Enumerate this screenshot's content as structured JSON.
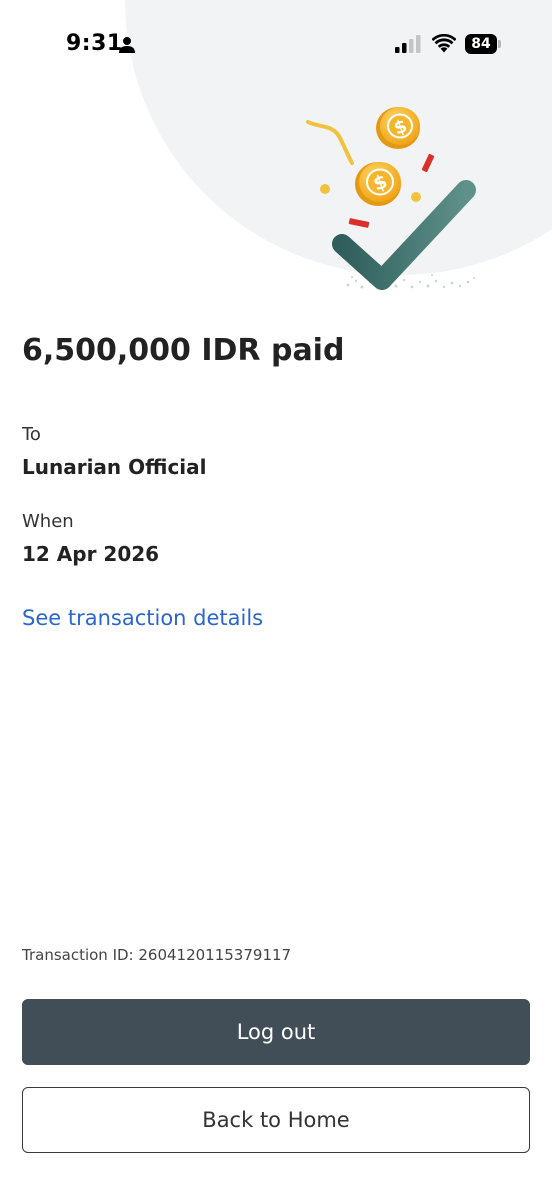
{
  "status_bar": {
    "time": "9:31",
    "battery": "84",
    "icons": [
      "person-icon",
      "cellular-signal-icon",
      "wifi-icon",
      "battery-icon"
    ]
  },
  "illustration": {
    "icons": [
      "coin-dollar-icon",
      "checkmark-icon",
      "confetti-icon"
    ],
    "colors": {
      "check": "#3f6e6a",
      "coin": "#f5b324",
      "confetti_red": "#d9302c",
      "confetti_yellow": "#f2c23e",
      "backdrop": "#f2f3f5"
    }
  },
  "payment": {
    "title": "6,500,000 IDR paid",
    "to_label": "To",
    "to_value": "Lunarian Official",
    "when_label": "When",
    "when_value": "12 Apr 2026",
    "details_link": "See transaction details"
  },
  "footer": {
    "transaction_id": "Transaction ID: 2604120115379117",
    "logout_label": "Log out",
    "home_label": "Back to Home"
  },
  "colors": {
    "link": "#2b66c9",
    "primary_button": "#414e58",
    "text": "#222222"
  }
}
